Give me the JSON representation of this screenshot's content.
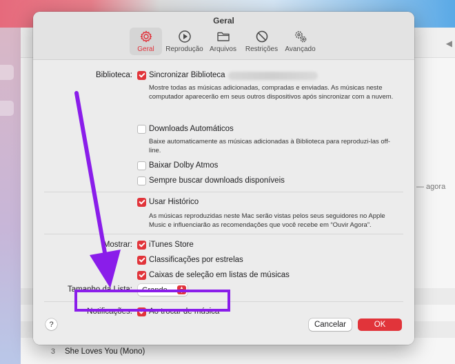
{
  "dialog": {
    "title": "Geral",
    "tabs": [
      {
        "label": "Geral",
        "icon": "gear-icon",
        "active": true
      },
      {
        "label": "Reprodução",
        "icon": "play-icon",
        "active": false
      },
      {
        "label": "Arquivos",
        "icon": "folder-icon",
        "active": false
      },
      {
        "label": "Restrições",
        "icon": "restriction-icon",
        "active": false
      },
      {
        "label": "Avançado",
        "icon": "gears-icon",
        "active": false
      }
    ]
  },
  "library": {
    "label": "Biblioteca:",
    "sync_label": "Sincronizar Biblioteca",
    "sync_desc": "Mostre todas as músicas adicionadas, compradas e enviadas. As músicas neste computador aparecerão em seus outros dispositivos após sincronizar com a nuvem.",
    "auto_downloads_label": "Downloads Automáticos",
    "auto_downloads_desc": "Baixe automaticamente as músicas adicionadas à Biblioteca para reproduzi-las off-line.",
    "dolby_label": "Baixar Dolby Atmos",
    "always_search_label": "Sempre buscar downloads disponíveis"
  },
  "history": {
    "label": "Usar Histórico",
    "desc": "As músicas reproduzidas neste Mac serão vistas pelos seus seguidores no Apple Music e influenciarão as recomendações que você recebe em “Ouvir Agora”."
  },
  "show": {
    "label": "Mostrar:",
    "itunes_store": "iTunes Store",
    "star_ratings": "Classificações por estrelas",
    "checkboxes": "Caixas de seleção em listas de músicas"
  },
  "list_size": {
    "label": "Tamanho da Lista:",
    "value": "Grande"
  },
  "notifications": {
    "label": "Notificações:",
    "option": "Ao trocar de música"
  },
  "footer": {
    "help": "?",
    "cancel": "Cancelar",
    "ok": "OK"
  },
  "background": {
    "ago_text": "— agora",
    "song_number": "3",
    "song_title": "She Loves You (Mono)"
  },
  "colors": {
    "accent": "#e1343a",
    "annotation": "#8a1dea"
  }
}
